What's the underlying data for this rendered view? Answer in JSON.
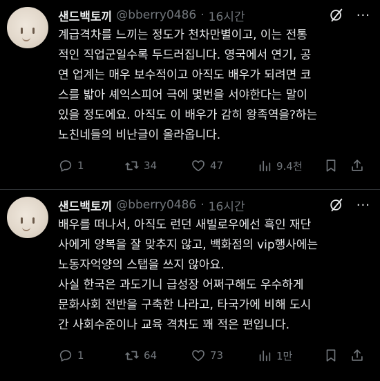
{
  "tweets": [
    {
      "author": {
        "name": "샌드백토끼",
        "handle": "@bberry0486"
      },
      "time": "16시간",
      "more": "···",
      "text": "계급격차를 느끼는 정도가 천차만별이고, 이는 전통\n적인 직업군일수록 두드러집니다. 영국에서 연기, 공\n연 업계는 매우 보수적이고 아직도 배우가 되려면 코\n스를 밟아 셰익스피어 극에 몇번을 서야한다는 말이\n있을 정도에요. 아직도 이 배우가 감히 왕족역을?하는\n노친네들의 비난글이 올라옵니다.",
      "stats": {
        "replies": "1",
        "retweets": "34",
        "likes": "47",
        "views": "9.4천"
      }
    },
    {
      "author": {
        "name": "샌드백토끼",
        "handle": "@bberry0486"
      },
      "time": "16시간",
      "more": "···",
      "text": "배우를 떠나서, 아직도 런던 새빌로우에선 흑인 재단\n사에게 양복을 잘 맞추지 않고, 백화점의 vip행사에는\n노동자억양의 스탭을 쓰지 않아요.\n사실 한국은 과도기니 급성장 어쩌구해도 우수하게\n문화사회 전반을 구축한 나라고, 타국가에 비해 도시\n간 사회수준이나 교육 격차도 꽤 적은 편입니다.",
      "stats": {
        "replies": "1",
        "retweets": "64",
        "likes": "73",
        "views": "1만"
      }
    }
  ],
  "icons": {
    "reply": "reply-icon",
    "retweet": "retweet-icon",
    "like": "heart-icon",
    "views": "views-icon",
    "bookmark": "bookmark-icon",
    "share": "share-icon",
    "grok": "grok-icon"
  },
  "colors": {
    "background": "#000000",
    "text": "#e7e9ea",
    "secondary": "#71767b",
    "divider": "#2f3336"
  }
}
